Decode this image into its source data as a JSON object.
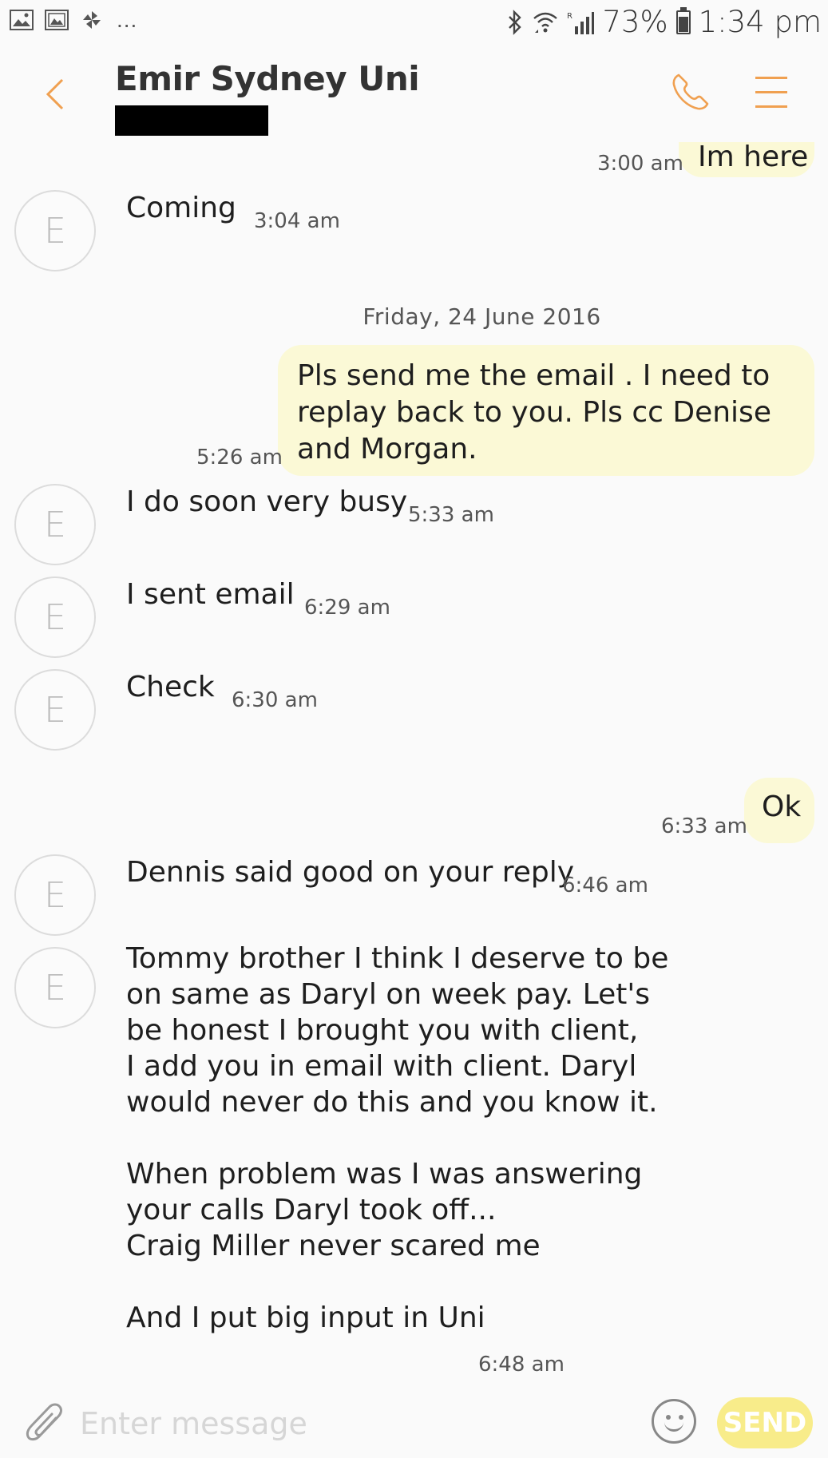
{
  "status_bar": {
    "icons_left": [
      "gallery-icon",
      "photo-icon",
      "pinwheel-icon"
    ],
    "more": "...",
    "battery": "73%",
    "battery_level": 0.73,
    "time": "1:34 pm",
    "icons_right": [
      "bluetooth-icon",
      "wifi-icon",
      "signal-icon",
      "battery-icon"
    ]
  },
  "header": {
    "contact_name": "Emir Sydney Uni",
    "accent_color": "#f0a050"
  },
  "avatar_letter": "E",
  "messages": [
    {
      "direction": "out",
      "text": "Im here",
      "time": "3:00 am"
    },
    {
      "direction": "in",
      "text": "Coming",
      "time": "3:04 am"
    },
    {
      "type": "date",
      "text": "Friday, 24 June 2016"
    },
    {
      "direction": "out",
      "lines": [
        "Pls send me the email . I need to",
        "replay back to you.  Pls cc Denise",
        "and Morgan."
      ],
      "time": "5:26 am"
    },
    {
      "direction": "in",
      "text": "I do soon very busy",
      "time": "5:33 am"
    },
    {
      "direction": "in",
      "text": "I sent email",
      "time": "6:29 am"
    },
    {
      "direction": "in",
      "text": "Check",
      "time": "6:30 am"
    },
    {
      "direction": "out",
      "text": "Ok",
      "time": "6:33 am"
    },
    {
      "direction": "in",
      "text": "Dennis said good on your reply",
      "time": "6:46 am"
    },
    {
      "direction": "in",
      "text": "Tommy brother I think I deserve to be\non same as Daryl on week pay. Let's\nbe honest I brought you with client,\nI add you in email with client. Daryl\nwould never do this and you know it.\n\nWhen problem was I was answering\nyour calls Daryl took off...\nCraig Miller never scared me\n\nAnd I put big input in Uni",
      "time": "6:48 am"
    }
  ],
  "input_bar": {
    "placeholder": "Enter message",
    "send_label": "SEND",
    "send_color": "#f8ec8a"
  }
}
